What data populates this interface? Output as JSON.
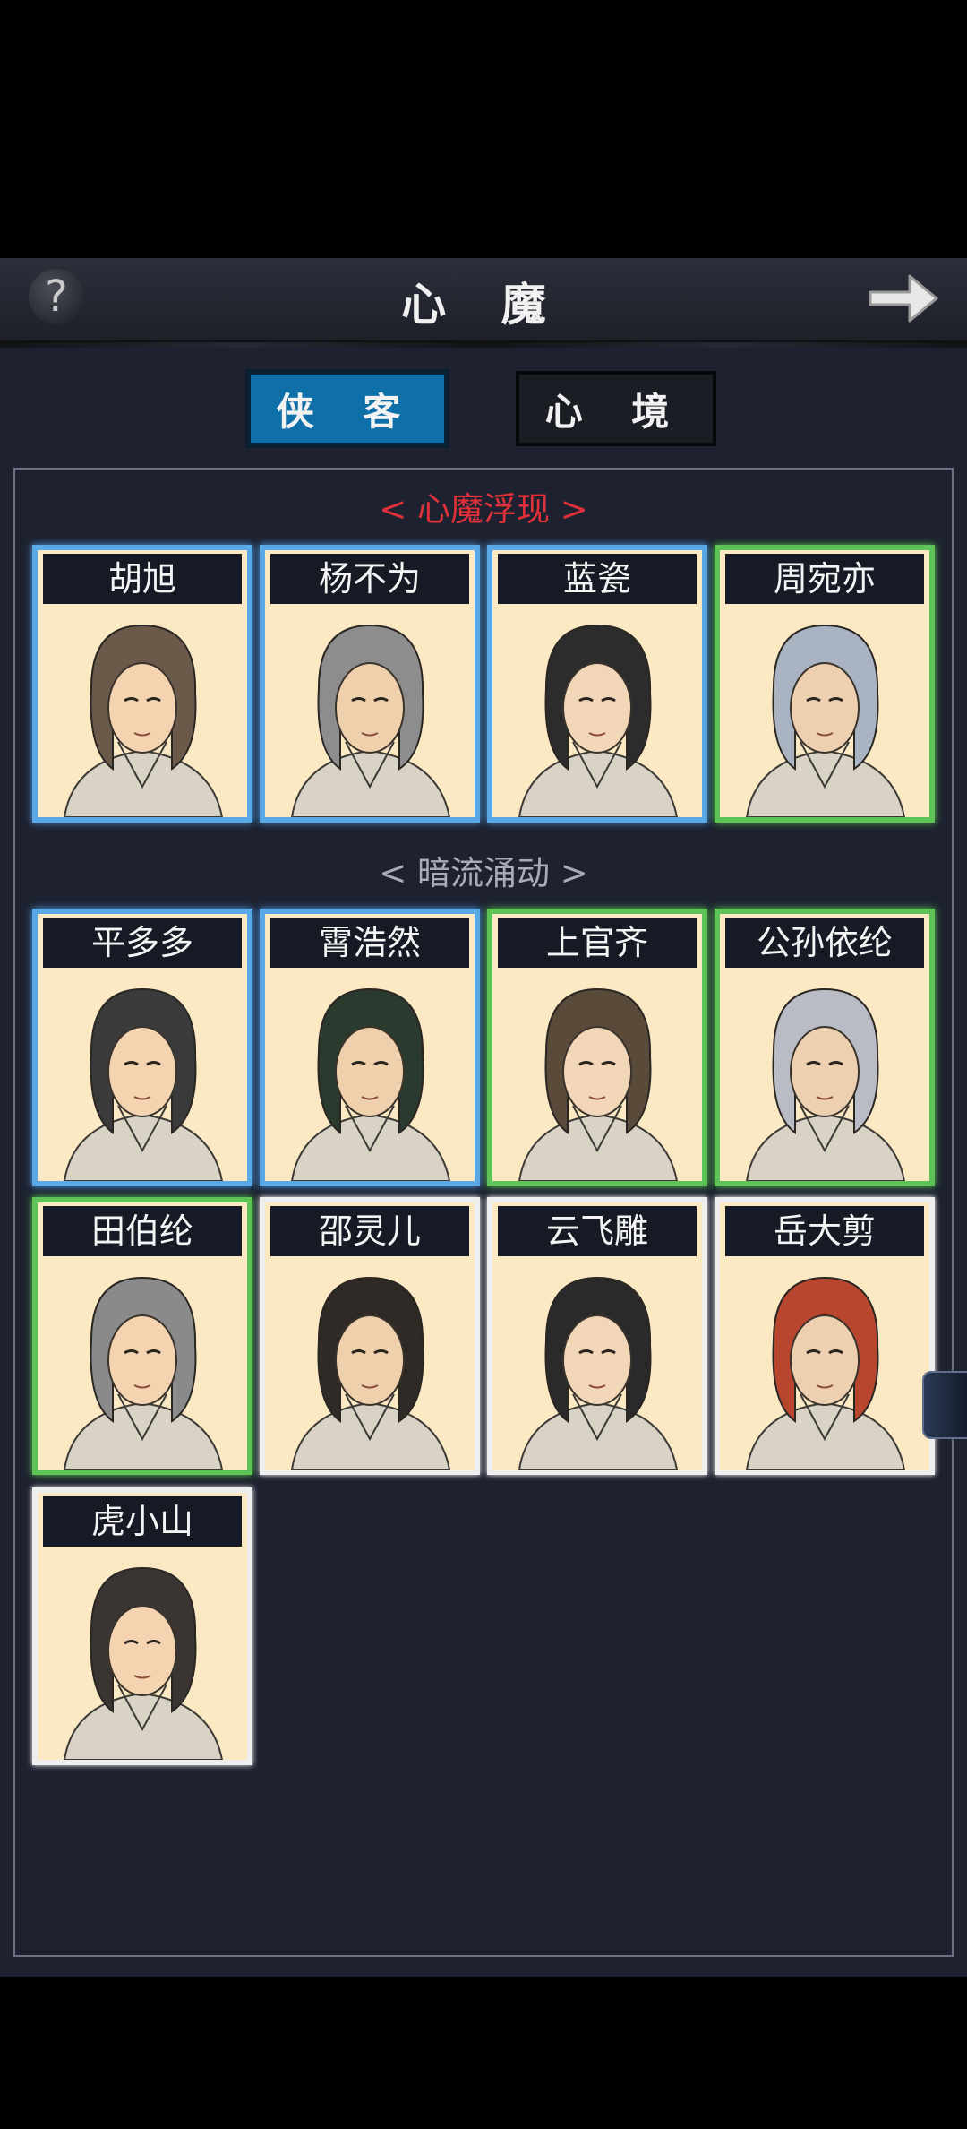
{
  "header": {
    "title": "心 魔",
    "help_glyph": "?",
    "help_icon": "question-mark-icon",
    "next_icon": "arrow-right-icon"
  },
  "tabs": [
    {
      "label": "侠 客",
      "active": true
    },
    {
      "label": "心 境",
      "active": false
    }
  ],
  "sections": [
    {
      "title": "< 心魔浮现 >",
      "color": "#e0303a"
    },
    {
      "title": "< 暗流涌动 >",
      "color": "#a9acb5"
    }
  ],
  "characters": [
    {
      "name": "胡旭",
      "frame": "blue",
      "section": 0
    },
    {
      "name": "杨不为",
      "frame": "blue",
      "section": 0
    },
    {
      "name": "蓝瓷",
      "frame": "blue",
      "section": 0
    },
    {
      "name": "周宛亦",
      "frame": "green",
      "section": 0
    },
    {
      "name": "平多多",
      "frame": "blue",
      "section": 1
    },
    {
      "name": "霄浩然",
      "frame": "blue",
      "section": 1
    },
    {
      "name": "上官齐",
      "frame": "green",
      "section": 1
    },
    {
      "name": "公孙依纶",
      "frame": "green",
      "section": 1
    },
    {
      "name": "田伯纶",
      "frame": "green",
      "section": 1
    },
    {
      "name": "邵灵儿",
      "frame": "white",
      "section": 1
    },
    {
      "name": "云飞雕",
      "frame": "white",
      "section": 1
    },
    {
      "name": "岳大剪",
      "frame": "white",
      "section": 1
    },
    {
      "name": "虎小山",
      "frame": "white",
      "section": 1
    }
  ],
  "colors": {
    "background": "#1e2230",
    "accent_blue": "#0f6fa8",
    "frame_blue": "#5aa8e6",
    "frame_green": "#5ec356",
    "frame_white": "#eeeeee",
    "card_bg": "#fbe9c3",
    "section_red": "#e0303a"
  }
}
